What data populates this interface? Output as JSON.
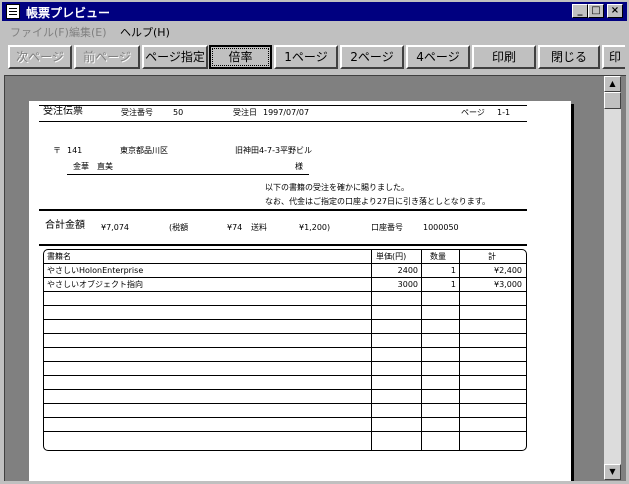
{
  "window": {
    "title": "帳票プレビュー"
  },
  "controls": {
    "minimize": "_",
    "maximize": "□",
    "close": "×"
  },
  "menu": [
    {
      "label": "ファイル(F)"
    },
    {
      "label": "編集(E)"
    },
    {
      "label": "ヘルプ(H)"
    }
  ],
  "toolbar": {
    "next_page": "次ページ",
    "prev_page": "前ページ",
    "page_specify": "ページ指定",
    "zoom": "倍率",
    "page1": "1ページ",
    "page2": "2ページ",
    "page4": "4ページ",
    "print": "印刷",
    "close": "閉じる",
    "extra": "印"
  },
  "scrollbar": {
    "up": "▲",
    "down": "▼"
  },
  "report": {
    "title": "受注伝票",
    "order_no_label": "受注番号",
    "order_no": "50",
    "order_date_label": "受注日",
    "order_date": "1997/07/07",
    "page_label": "ページ",
    "page_value": "1-1",
    "postal_mark": "〒",
    "postal_code": "141",
    "address1": "東京都品川区",
    "address2": "旧神田4-7-3平野ビル",
    "customer": "金華　直美",
    "honorific": "様",
    "message1": "以下の書籍の受注を確かに賜りました。",
    "message2": "なお、代金はご指定の口座より27日に引き落としとなります。",
    "total_label": "合計金額",
    "total_value": "¥7,074",
    "tax_label": "(税額",
    "tax_value": "¥74",
    "shipping_label": "送料",
    "shipping_value": "¥1,200)",
    "account_label": "口座番号",
    "account_value": "1000050",
    "table": {
      "headers": {
        "name": "書籍名",
        "price": "単価(円)",
        "qty": "数量",
        "total": "計"
      },
      "rows": [
        {
          "name": "やさしいHolonEnterprise",
          "price": "2400",
          "qty": "1",
          "total": "¥2,400"
        },
        {
          "name": "やさしいオブジェクト指向",
          "price": "3000",
          "qty": "1",
          "total": "¥3,000"
        }
      ]
    }
  }
}
